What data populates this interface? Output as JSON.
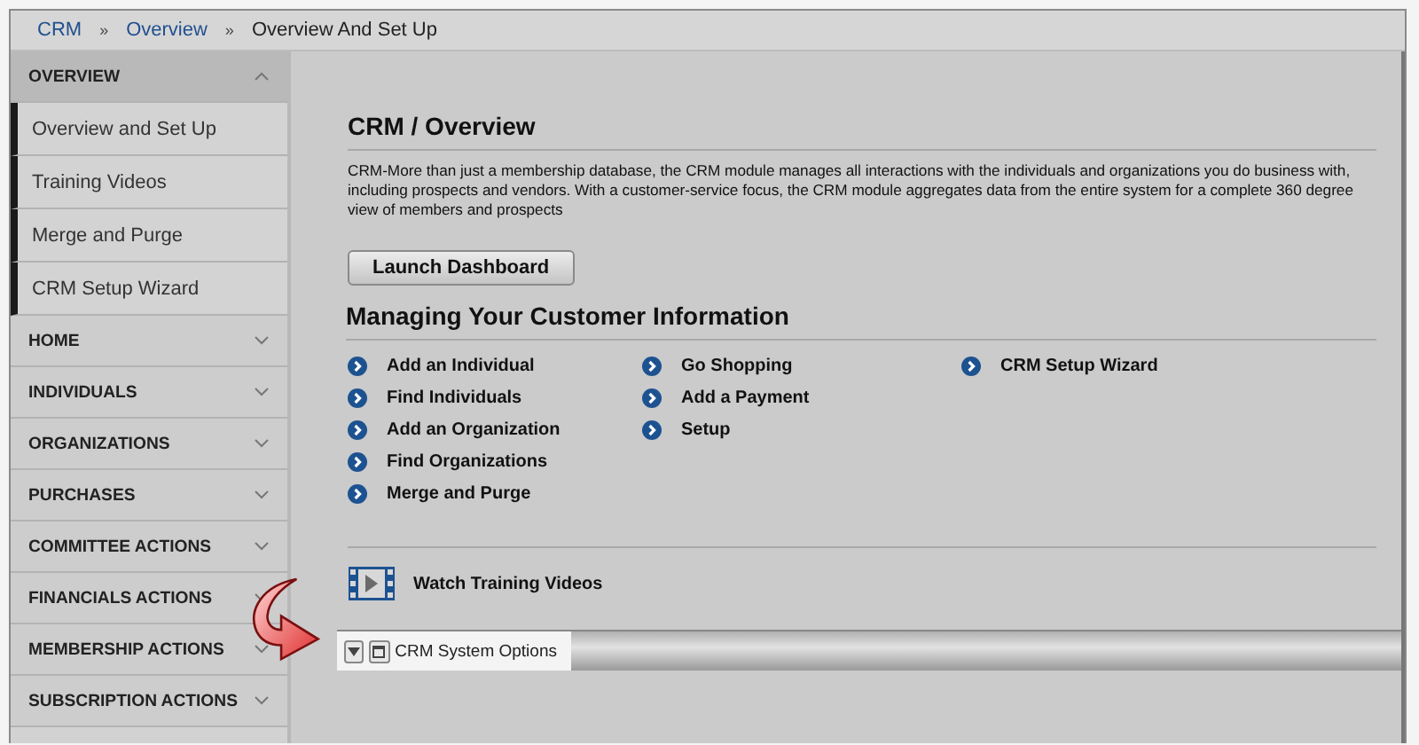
{
  "breadcrumb": [
    {
      "label": "CRM",
      "kind": "link"
    },
    {
      "label": "»",
      "kind": "separator"
    },
    {
      "label": "Overview",
      "kind": "link"
    },
    {
      "label": "»",
      "kind": "separator"
    },
    {
      "label": "Overview And Set Up",
      "kind": "current"
    }
  ],
  "sidebar": {
    "groups": [
      {
        "label": "OVERVIEW",
        "expanded": true,
        "children": [
          {
            "label": "Overview and Set Up"
          },
          {
            "label": "Training Videos"
          },
          {
            "label": "Merge and Purge"
          },
          {
            "label": "CRM Setup Wizard"
          }
        ]
      },
      {
        "label": "HOME",
        "expanded": false
      },
      {
        "label": "INDIVIDUALS",
        "expanded": false
      },
      {
        "label": "ORGANIZATIONS",
        "expanded": false
      },
      {
        "label": "PURCHASES",
        "expanded": false
      },
      {
        "label": "COMMITTEE ACTIONS",
        "expanded": false
      },
      {
        "label": "FINANCIALS ACTIONS",
        "expanded": false
      },
      {
        "label": "MEMBERSHIP ACTIONS",
        "expanded": false
      },
      {
        "label": "SUBSCRIPTION ACTIONS",
        "expanded": false
      }
    ]
  },
  "main": {
    "title": "CRM / Overview",
    "description": "CRM-More than just a membership database, the CRM module manages all interactions with the individuals and organizations you do business with, including prospects and vendors. With a customer-service focus, the CRM module aggregates data from the entire system for a complete 360 degree view of members and prospects",
    "button": "Launch Dashboard",
    "section_title": "Managing Your Customer Information",
    "link_columns": [
      [
        "Add an Individual",
        "Find Individuals",
        "Add an Organization",
        "Find Organizations",
        "Merge and Purge"
      ],
      [
        "Go Shopping",
        "Add a Payment",
        "Setup"
      ],
      [
        "CRM Setup Wizard"
      ]
    ],
    "video_link": "Watch Training Videos"
  },
  "options_panel": {
    "title": "CRM System Options"
  }
}
